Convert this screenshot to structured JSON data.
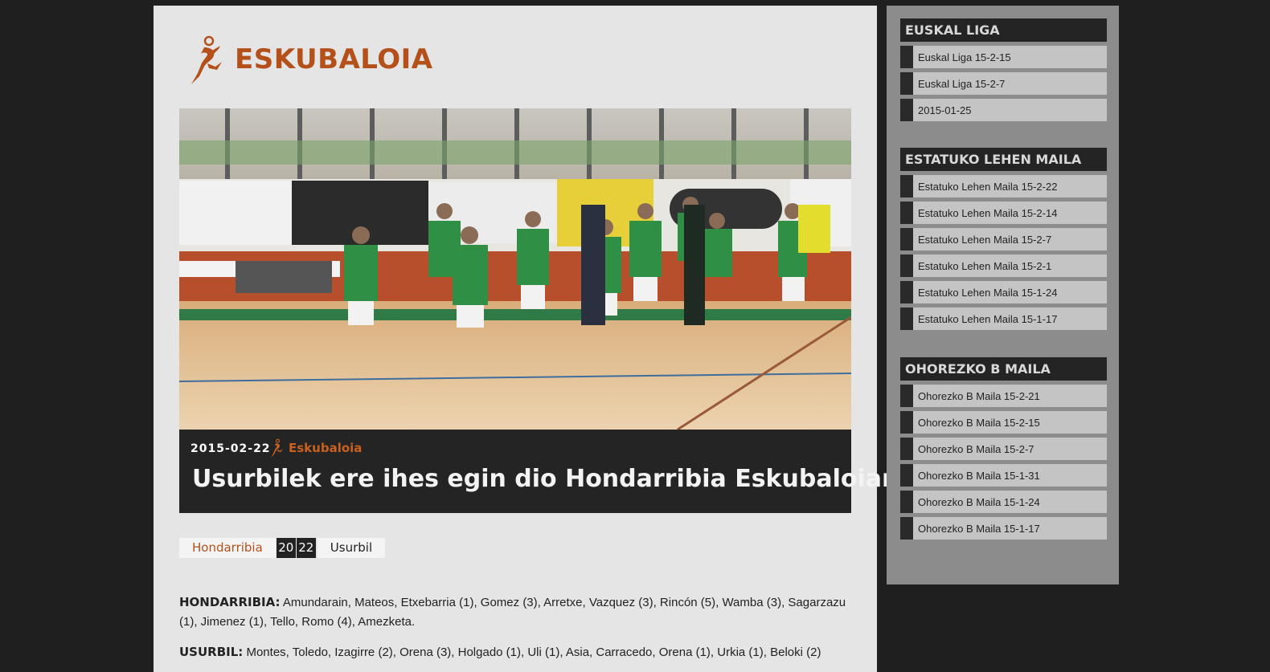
{
  "site": {
    "title": "ESKUBALOIA"
  },
  "article": {
    "date": "2015-02-22",
    "author": "Eskubaloia",
    "headline": "Usurbilek ere ihes egin dio Hondarribia Eskubaloiari"
  },
  "match": {
    "home": "Hondarribia",
    "home_score": "20",
    "away_score": "22",
    "away": "Usurbil"
  },
  "lineups": [
    {
      "team": "HONDARRIBIA:",
      "players": "Amundarain, Mateos, Etxebarria (1), Gomez (3), Arretxe, Vazquez (3), Rincón (5), Wamba (3), Sagarzazu (1), Jimenez (1), Tello, Romo (4), Amezketa."
    },
    {
      "team": "USURBIL:",
      "players": "Montes, Toledo, Izagirre (2), Orena (3), Holgado (1), Uli (1), Asia, Carracedo, Orena (1), Urkia (1), Beloki (2)"
    }
  ],
  "sidebar": {
    "sections": [
      {
        "title": "EUSKAL LIGA",
        "items": [
          "Euskal Liga 15-2-15",
          "Euskal Liga 15-2-7",
          "2015-01-25"
        ]
      },
      {
        "title": "ESTATUKO LEHEN MAILA",
        "items": [
          "Estatuko Lehen Maila 15-2-22",
          "Estatuko Lehen Maila 15-2-14",
          "Estatuko Lehen Maila 15-2-7",
          "Estatuko Lehen Maila 15-2-1",
          "Estatuko Lehen Maila 15-1-24",
          "Estatuko Lehen Maila 15-1-17"
        ]
      },
      {
        "title": "OHOREZKO B MAILA",
        "items": [
          "Ohorezko B Maila 15-2-21",
          "Ohorezko B Maila 15-2-15",
          "Ohorezko B Maila 15-2-7",
          "Ohorezko B Maila 15-1-31",
          "Ohorezko B Maila 15-1-24",
          "Ohorezko B Maila 15-1-17"
        ]
      }
    ]
  },
  "colors": {
    "brand": "#b4501a",
    "dark": "#242424",
    "panel": "#8c8c8c"
  }
}
